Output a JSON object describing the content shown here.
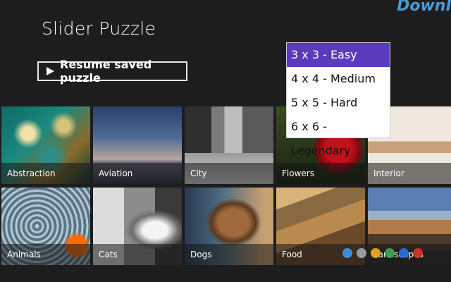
{
  "app": {
    "title": "Slider Puzzle"
  },
  "resume": {
    "label": "Resume saved puzzle",
    "icon": "play-icon"
  },
  "categories": [
    {
      "label": "Abstraction"
    },
    {
      "label": "Aviation"
    },
    {
      "label": "City"
    },
    {
      "label": "Flowers"
    },
    {
      "label": "Interior"
    },
    {
      "label": "Animals"
    },
    {
      "label": "Cats"
    },
    {
      "label": "Dogs"
    },
    {
      "label": "Food"
    },
    {
      "label": "Landscapes"
    }
  ],
  "difficulty_menu": {
    "selected_index": 0,
    "options": [
      {
        "label": "3 x 3 - Easy"
      },
      {
        "label": "4 x 4 - Medium"
      },
      {
        "label": "5 x 5 - Hard"
      },
      {
        "label": "6 x 6 - Legendary"
      }
    ],
    "accent": "#5b3bbd"
  },
  "watermark": {
    "text": "Downl"
  }
}
